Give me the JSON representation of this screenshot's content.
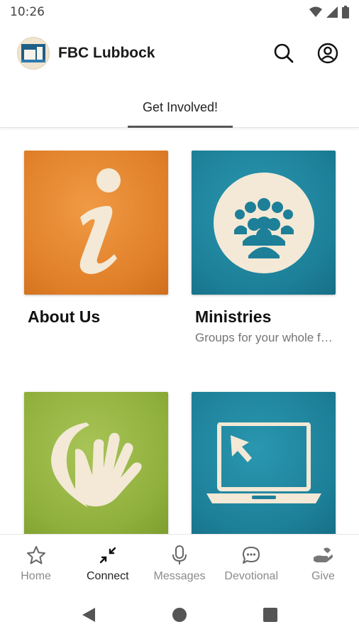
{
  "status_bar": {
    "time": "10:26"
  },
  "header": {
    "title": "FBC Lubbock"
  },
  "tabs": [
    {
      "label": "Get Involved!"
    }
  ],
  "cards": [
    {
      "title": "About Us",
      "subtitle": ""
    },
    {
      "title": "Ministries",
      "subtitle": "Groups for your whole family"
    },
    {
      "title": "",
      "subtitle": ""
    },
    {
      "title": "",
      "subtitle": ""
    }
  ],
  "bottom_nav": [
    {
      "label": "Home",
      "icon": "star-icon"
    },
    {
      "label": "Connect",
      "icon": "connect-icon",
      "active": true
    },
    {
      "label": "Messages",
      "icon": "microphone-icon"
    },
    {
      "label": "Devotional",
      "icon": "chat-bubble-icon"
    },
    {
      "label": "Give",
      "icon": "giving-hand-icon"
    }
  ],
  "colors": {
    "orange": "#e07f28",
    "teal": "#1d7f98",
    "green": "#8faf3b",
    "cream": "#f3e9d6"
  }
}
